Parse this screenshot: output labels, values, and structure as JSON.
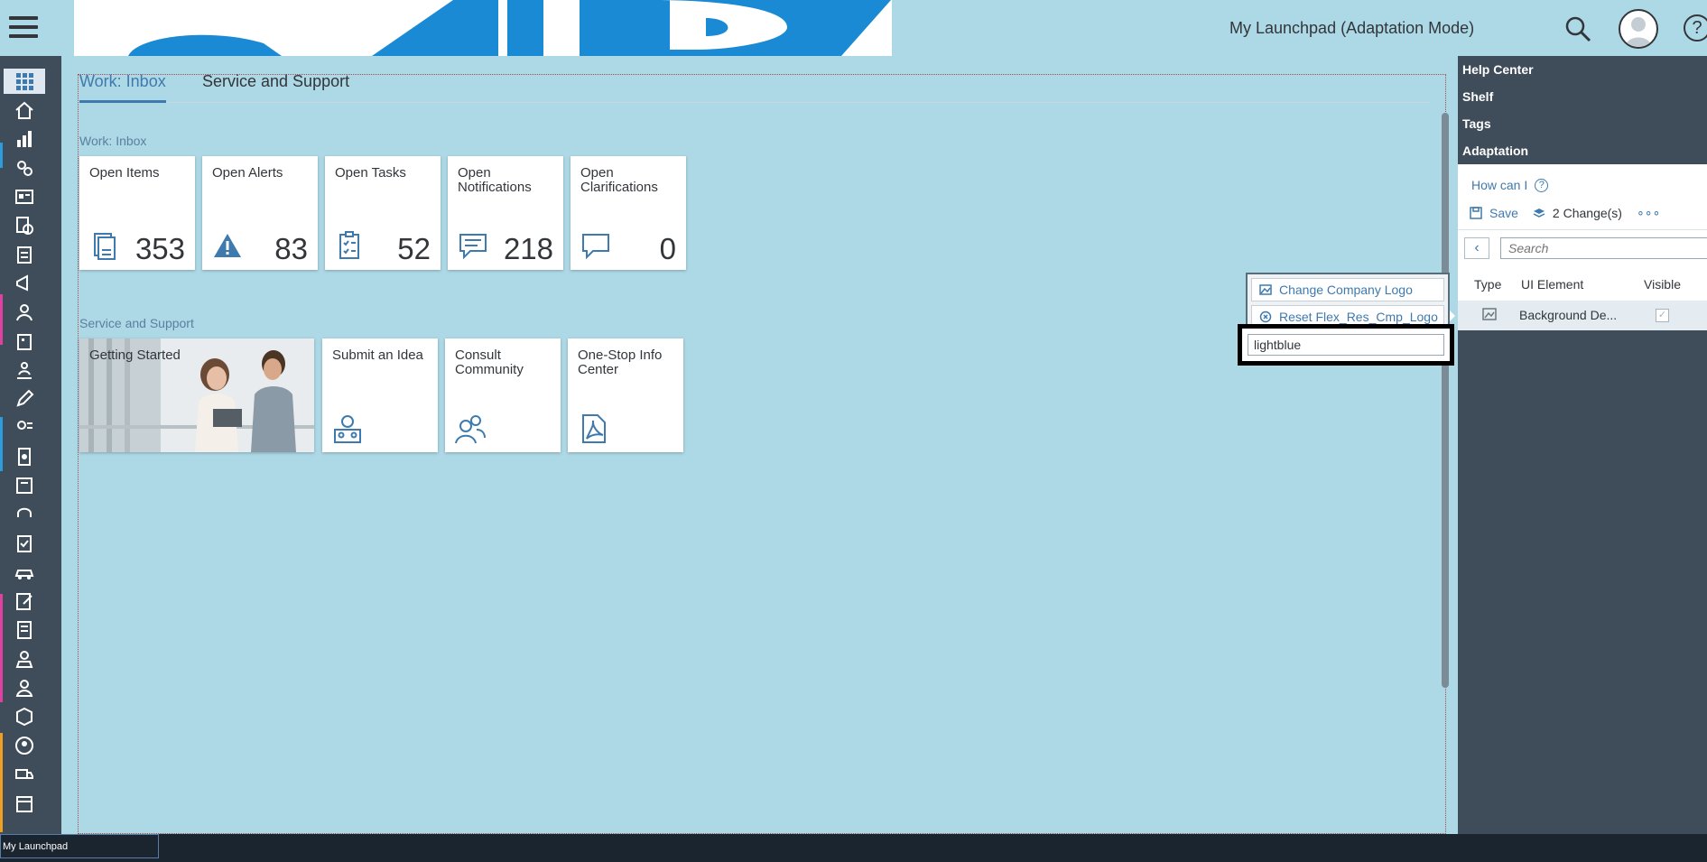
{
  "header": {
    "title": "My Launchpad (Adaptation Mode)",
    "menu_icon": "hamburger-menu-icon",
    "search_icon": "search-icon",
    "avatar_icon": "user-avatar-icon",
    "help_icon": "help-icon",
    "help_glyph": "?"
  },
  "tabs": [
    {
      "label": "Work: Inbox",
      "selected": true
    },
    {
      "label": "Service and Support",
      "selected": false
    }
  ],
  "sections": {
    "work_inbox": {
      "title": "Work: Inbox",
      "tiles": [
        {
          "title": "Open Items",
          "count": "353",
          "icon": "document-icon"
        },
        {
          "title": "Open Alerts",
          "count": "83",
          "icon": "alert-icon"
        },
        {
          "title": "Open Tasks",
          "count": "52",
          "icon": "task-icon"
        },
        {
          "title": "Open Notifications",
          "count": "218",
          "icon": "notification-icon"
        },
        {
          "title": "Open Clarifications",
          "count": "0",
          "icon": "message-icon"
        }
      ]
    },
    "service_support": {
      "title": "Service and Support",
      "tiles": [
        {
          "title": "Getting Started",
          "icon": "photo"
        },
        {
          "title": "Submit an Idea",
          "icon": "idea-icon"
        },
        {
          "title": "Consult Community",
          "icon": "community-icon"
        },
        {
          "title": "One-Stop Info Center",
          "icon": "pdf-icon"
        }
      ]
    }
  },
  "context_menu": {
    "change_logo": "Change Company Logo",
    "reset_logo": "Reset Flex_Res_Cmp_Logo",
    "input_value": "lightblue"
  },
  "right_panel": {
    "links": [
      "Help Center",
      "Shelf",
      "Tags",
      "Adaptation"
    ],
    "how_can_i": "How can I",
    "how_can_i_glyph": "?",
    "save_label": "Save",
    "changes_label": "2 Change(s)",
    "more_label": "∘∘∘",
    "back_glyph": "‹",
    "search_placeholder": "Search",
    "columns": [
      "Type",
      "UI Element",
      "Visible"
    ],
    "rows": [
      {
        "type_icon": "image-icon",
        "ui_element": "Background De...",
        "visible": true
      }
    ],
    "check_glyph": "✓"
  },
  "taskbar": {
    "item": "My Launchpad"
  },
  "colors": {
    "background": "#add8e6",
    "accent": "#3f7aae",
    "sidebar": "#3f4c5a"
  }
}
